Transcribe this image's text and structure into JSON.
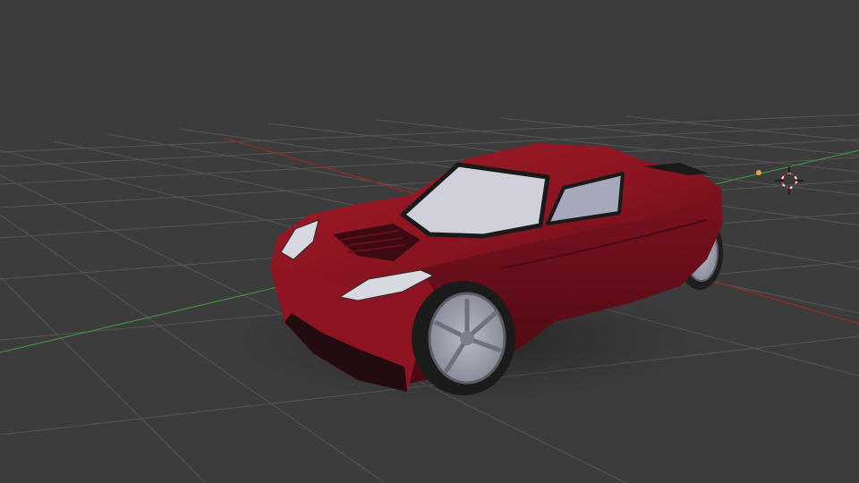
{
  "viewport": {
    "background_color": "#3c3c3c",
    "grid_color": "#595959",
    "x_axis_color": "#9b2a2a",
    "y_axis_color": "#3f8f3f"
  },
  "scene_objects": [
    {
      "name": "car-model",
      "type": "mesh",
      "body_color": "#8c1622",
      "glass_color": "#c9cad6",
      "wheel_color": "#9a9caa"
    },
    {
      "name": "3d-cursor",
      "type": "cursor",
      "colors": [
        "#c62828",
        "#ffffff"
      ]
    },
    {
      "name": "light-object",
      "type": "light",
      "color": "#e6a23c"
    }
  ]
}
